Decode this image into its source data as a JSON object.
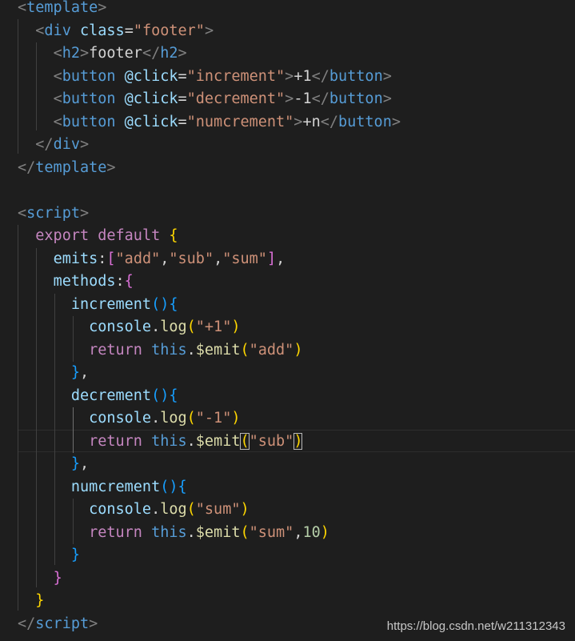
{
  "editor": {
    "lines": [
      {
        "tokens": [
          {
            "t": "<",
            "c": "tok-punct"
          },
          {
            "t": "template",
            "c": "tok-tag"
          },
          {
            "t": ">",
            "c": "tok-punct"
          }
        ]
      },
      {
        "tokens": [
          {
            "t": "  "
          },
          {
            "t": "<",
            "c": "tok-punct"
          },
          {
            "t": "div",
            "c": "tok-tag"
          },
          {
            "t": " "
          },
          {
            "t": "class",
            "c": "tok-attr"
          },
          {
            "t": "=",
            "c": "tok-op"
          },
          {
            "t": "\"footer\"",
            "c": "tok-str"
          },
          {
            "t": ">",
            "c": "tok-punct"
          }
        ]
      },
      {
        "tokens": [
          {
            "t": "    "
          },
          {
            "t": "<",
            "c": "tok-punct"
          },
          {
            "t": "h2",
            "c": "tok-tag"
          },
          {
            "t": ">",
            "c": "tok-punct"
          },
          {
            "t": "footer",
            "c": "tok-text"
          },
          {
            "t": "</",
            "c": "tok-punct"
          },
          {
            "t": "h2",
            "c": "tok-tag"
          },
          {
            "t": ">",
            "c": "tok-punct"
          }
        ]
      },
      {
        "tokens": [
          {
            "t": "    "
          },
          {
            "t": "<",
            "c": "tok-punct"
          },
          {
            "t": "button",
            "c": "tok-tag"
          },
          {
            "t": " "
          },
          {
            "t": "@click",
            "c": "tok-attr"
          },
          {
            "t": "=",
            "c": "tok-op"
          },
          {
            "t": "\"increment\"",
            "c": "tok-str"
          },
          {
            "t": ">",
            "c": "tok-punct"
          },
          {
            "t": "+1",
            "c": "tok-text"
          },
          {
            "t": "</",
            "c": "tok-punct"
          },
          {
            "t": "button",
            "c": "tok-tag"
          },
          {
            "t": ">",
            "c": "tok-punct"
          }
        ]
      },
      {
        "tokens": [
          {
            "t": "    "
          },
          {
            "t": "<",
            "c": "tok-punct"
          },
          {
            "t": "button",
            "c": "tok-tag"
          },
          {
            "t": " "
          },
          {
            "t": "@click",
            "c": "tok-attr"
          },
          {
            "t": "=",
            "c": "tok-op"
          },
          {
            "t": "\"decrement\"",
            "c": "tok-str"
          },
          {
            "t": ">",
            "c": "tok-punct"
          },
          {
            "t": "-1",
            "c": "tok-text"
          },
          {
            "t": "</",
            "c": "tok-punct"
          },
          {
            "t": "button",
            "c": "tok-tag"
          },
          {
            "t": ">",
            "c": "tok-punct"
          }
        ]
      },
      {
        "tokens": [
          {
            "t": "    "
          },
          {
            "t": "<",
            "c": "tok-punct"
          },
          {
            "t": "button",
            "c": "tok-tag"
          },
          {
            "t": " "
          },
          {
            "t": "@click",
            "c": "tok-attr"
          },
          {
            "t": "=",
            "c": "tok-op"
          },
          {
            "t": "\"numcrement\"",
            "c": "tok-str"
          },
          {
            "t": ">",
            "c": "tok-punct"
          },
          {
            "t": "+n",
            "c": "tok-text"
          },
          {
            "t": "</",
            "c": "tok-punct"
          },
          {
            "t": "button",
            "c": "tok-tag"
          },
          {
            "t": ">",
            "c": "tok-punct"
          }
        ]
      },
      {
        "tokens": [
          {
            "t": "  "
          },
          {
            "t": "</",
            "c": "tok-punct"
          },
          {
            "t": "div",
            "c": "tok-tag"
          },
          {
            "t": ">",
            "c": "tok-punct"
          }
        ]
      },
      {
        "tokens": [
          {
            "t": "</",
            "c": "tok-punct"
          },
          {
            "t": "template",
            "c": "tok-tag"
          },
          {
            "t": ">",
            "c": "tok-punct"
          }
        ]
      },
      {
        "tokens": []
      },
      {
        "tokens": [
          {
            "t": "<",
            "c": "tok-punct"
          },
          {
            "t": "script",
            "c": "tok-tag"
          },
          {
            "t": ">",
            "c": "tok-punct"
          }
        ]
      },
      {
        "tokens": [
          {
            "t": "  "
          },
          {
            "t": "export",
            "c": "tok-keyword"
          },
          {
            "t": " "
          },
          {
            "t": "default",
            "c": "tok-keyword"
          },
          {
            "t": " "
          },
          {
            "t": "{",
            "c": "tok-brace1"
          }
        ]
      },
      {
        "tokens": [
          {
            "t": "    "
          },
          {
            "t": "emits",
            "c": "tok-prop"
          },
          {
            "t": ":",
            "c": "tok-op"
          },
          {
            "t": "[",
            "c": "tok-brace2"
          },
          {
            "t": "\"add\"",
            "c": "tok-str"
          },
          {
            "t": ",",
            "c": "tok-op"
          },
          {
            "t": "\"sub\"",
            "c": "tok-str"
          },
          {
            "t": ",",
            "c": "tok-op"
          },
          {
            "t": "\"sum\"",
            "c": "tok-str"
          },
          {
            "t": "]",
            "c": "tok-brace2"
          },
          {
            "t": ",",
            "c": "tok-op"
          }
        ]
      },
      {
        "tokens": [
          {
            "t": "    "
          },
          {
            "t": "methods",
            "c": "tok-prop"
          },
          {
            "t": ":",
            "c": "tok-op"
          },
          {
            "t": "{",
            "c": "tok-brace2"
          }
        ]
      },
      {
        "tokens": [
          {
            "t": "      "
          },
          {
            "t": "increment",
            "c": "tok-prop"
          },
          {
            "t": "()",
            "c": "tok-brace3"
          },
          {
            "t": "{",
            "c": "tok-brace3"
          }
        ]
      },
      {
        "tokens": [
          {
            "t": "        "
          },
          {
            "t": "console",
            "c": "tok-var"
          },
          {
            "t": ".",
            "c": "tok-op"
          },
          {
            "t": "log",
            "c": "tok-func"
          },
          {
            "t": "(",
            "c": "tok-brace1"
          },
          {
            "t": "\"+1\"",
            "c": "tok-str"
          },
          {
            "t": ")",
            "c": "tok-brace1"
          }
        ]
      },
      {
        "tokens": [
          {
            "t": "        "
          },
          {
            "t": "return",
            "c": "tok-keyword"
          },
          {
            "t": " "
          },
          {
            "t": "this",
            "c": "tok-this"
          },
          {
            "t": ".",
            "c": "tok-op"
          },
          {
            "t": "$emit",
            "c": "tok-func"
          },
          {
            "t": "(",
            "c": "tok-brace1"
          },
          {
            "t": "\"add\"",
            "c": "tok-str"
          },
          {
            "t": ")",
            "c": "tok-brace1"
          }
        ]
      },
      {
        "tokens": [
          {
            "t": "      "
          },
          {
            "t": "}",
            "c": "tok-brace3"
          },
          {
            "t": ",",
            "c": "tok-op"
          }
        ]
      },
      {
        "tokens": [
          {
            "t": "      "
          },
          {
            "t": "decrement",
            "c": "tok-prop"
          },
          {
            "t": "()",
            "c": "tok-brace3"
          },
          {
            "t": "{",
            "c": "tok-brace3"
          }
        ]
      },
      {
        "tokens": [
          {
            "t": "        "
          },
          {
            "t": "console",
            "c": "tok-var"
          },
          {
            "t": ".",
            "c": "tok-op"
          },
          {
            "t": "log",
            "c": "tok-func"
          },
          {
            "t": "(",
            "c": "tok-brace1"
          },
          {
            "t": "\"-1\"",
            "c": "tok-str"
          },
          {
            "t": ")",
            "c": "tok-brace1"
          }
        ]
      },
      {
        "tokens": [
          {
            "t": "        "
          },
          {
            "t": "return",
            "c": "tok-keyword"
          },
          {
            "t": " "
          },
          {
            "t": "this",
            "c": "tok-this"
          },
          {
            "t": ".",
            "c": "tok-op"
          },
          {
            "t": "$emit",
            "c": "tok-func"
          },
          {
            "t": "(",
            "c": "tok-brace1 tok-bracket-match"
          },
          {
            "t": "\"sub\"",
            "c": "tok-str"
          },
          {
            "t": ")",
            "c": "tok-brace1 tok-bracket-match"
          }
        ]
      },
      {
        "tokens": [
          {
            "t": "      "
          },
          {
            "t": "}",
            "c": "tok-brace3"
          },
          {
            "t": ",",
            "c": "tok-op"
          }
        ]
      },
      {
        "tokens": [
          {
            "t": "      "
          },
          {
            "t": "numcrement",
            "c": "tok-prop"
          },
          {
            "t": "()",
            "c": "tok-brace3"
          },
          {
            "t": "{",
            "c": "tok-brace3"
          }
        ]
      },
      {
        "tokens": [
          {
            "t": "        "
          },
          {
            "t": "console",
            "c": "tok-var"
          },
          {
            "t": ".",
            "c": "tok-op"
          },
          {
            "t": "log",
            "c": "tok-func"
          },
          {
            "t": "(",
            "c": "tok-brace1"
          },
          {
            "t": "\"sum\"",
            "c": "tok-str"
          },
          {
            "t": ")",
            "c": "tok-brace1"
          }
        ]
      },
      {
        "tokens": [
          {
            "t": "        "
          },
          {
            "t": "return",
            "c": "tok-keyword"
          },
          {
            "t": " "
          },
          {
            "t": "this",
            "c": "tok-this"
          },
          {
            "t": ".",
            "c": "tok-op"
          },
          {
            "t": "$emit",
            "c": "tok-func"
          },
          {
            "t": "(",
            "c": "tok-brace1"
          },
          {
            "t": "\"sum\"",
            "c": "tok-str"
          },
          {
            "t": ",",
            "c": "tok-op"
          },
          {
            "t": "10",
            "c": "tok-num"
          },
          {
            "t": ")",
            "c": "tok-brace1"
          }
        ]
      },
      {
        "tokens": [
          {
            "t": "      "
          },
          {
            "t": "}",
            "c": "tok-brace3"
          }
        ]
      },
      {
        "tokens": [
          {
            "t": "    "
          },
          {
            "t": "}",
            "c": "tok-brace2"
          }
        ]
      },
      {
        "tokens": [
          {
            "t": "  "
          },
          {
            "t": "}",
            "c": "tok-brace1"
          }
        ]
      },
      {
        "tokens": [
          {
            "t": "</",
            "c": "tok-punct"
          },
          {
            "t": "script",
            "c": "tok-tag"
          },
          {
            "t": ">",
            "c": "tok-punct"
          }
        ]
      }
    ]
  },
  "watermark": {
    "text": "https://blog.csdn.net/w211312343"
  }
}
